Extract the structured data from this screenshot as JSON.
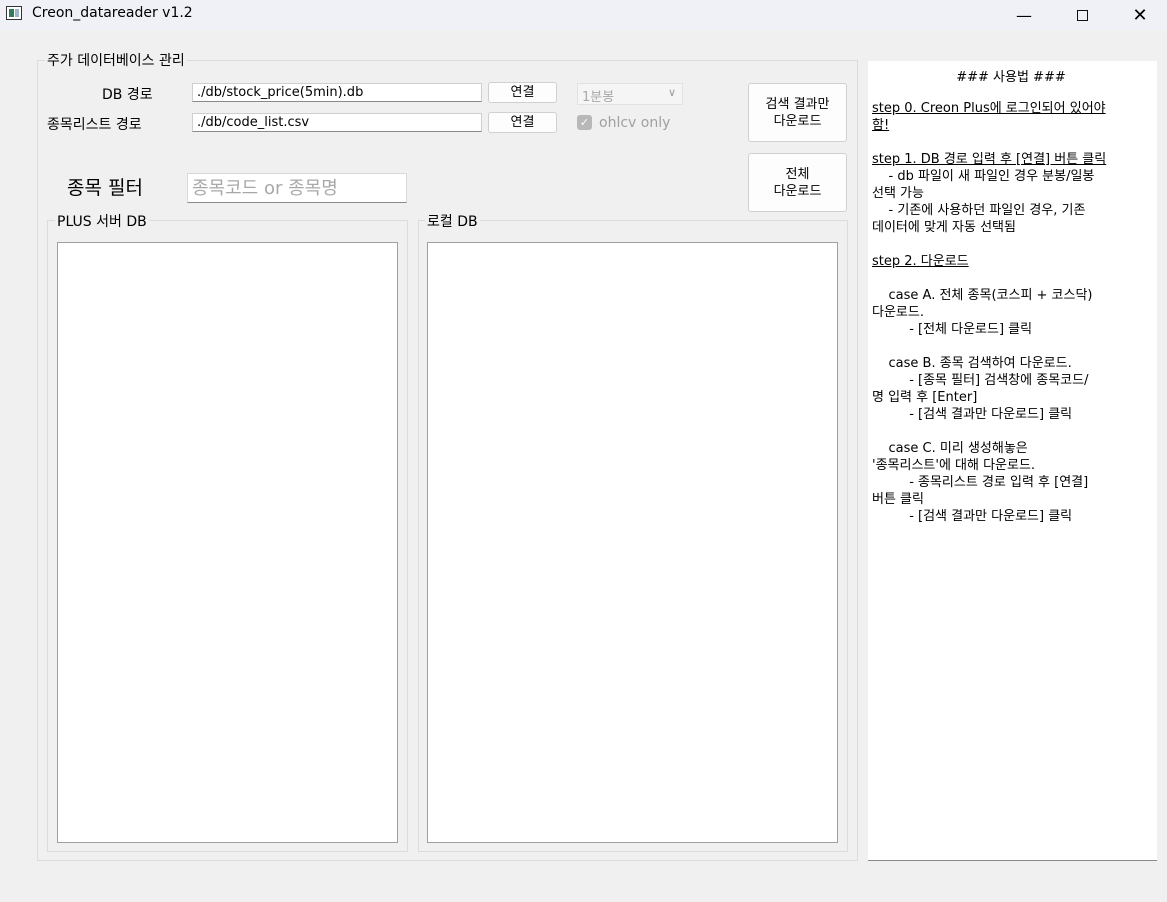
{
  "window": {
    "title": "Creon_datareader v1.2",
    "controls": {
      "minimize": "—",
      "close": "✕"
    }
  },
  "db_group": {
    "title": "주가 데이터베이스 관리",
    "db_path_label": "DB 경로",
    "db_path_value": "./db/stock_price(5min).db",
    "db_connect_label": "연결",
    "list_path_label": "종목리스트 경로",
    "list_path_value": "./db/code_list.csv",
    "list_connect_label": "연결",
    "interval_value": "1분봉",
    "ohlcv_only_label": "ohlcv only",
    "ohlcv_only_checked": true,
    "download_search_label": "검색 결과만\n다운로드",
    "download_all_label": "전체\n다운로드",
    "filter_label": "종목 필터",
    "filter_placeholder": "종목코드 or 종목명",
    "plus_server_title": "PLUS 서버 DB",
    "local_title": "로컬 DB"
  },
  "help": {
    "title": "### 사용법 ###",
    "lines": [
      {
        "text": "step 0. Creon Plus에 로그인되어 있어야",
        "u": true
      },
      {
        "text": "함!",
        "u": true
      },
      {
        "text": "",
        "u": false
      },
      {
        "text": "step 1. DB 경로 입력 후 [연결] 버튼 클릭",
        "u": true
      },
      {
        "text": "    - db 파일이 새 파일인 경우 분봉/일봉",
        "u": false
      },
      {
        "text": "선택 가능",
        "u": false
      },
      {
        "text": "    - 기존에 사용하던 파일인 경우, 기존",
        "u": false
      },
      {
        "text": "데이터에 맞게 자동 선택됨",
        "u": false
      },
      {
        "text": "",
        "u": false
      },
      {
        "text": "step 2. 다운로드",
        "u": true
      },
      {
        "text": "",
        "u": false
      },
      {
        "text": "    case A. 전체 종목(코스피 + 코스닥)",
        "u": false
      },
      {
        "text": "다운로드.",
        "u": false
      },
      {
        "text": "         - [전체 다운로드] 클릭",
        "u": false
      },
      {
        "text": "",
        "u": false
      },
      {
        "text": "    case B. 종목 검색하여 다운로드.",
        "u": false
      },
      {
        "text": "         - [종목 필터] 검색창에 종목코드/",
        "u": false
      },
      {
        "text": "명 입력 후 [Enter]",
        "u": false
      },
      {
        "text": "         - [검색 결과만 다운로드] 클릭",
        "u": false
      },
      {
        "text": "",
        "u": false
      },
      {
        "text": "    case C. 미리 생성해놓은",
        "u": false
      },
      {
        "text": "'종목리스트'에 대해 다운로드.",
        "u": false
      },
      {
        "text": "         - 종목리스트 경로 입력 후 [연결]",
        "u": false
      },
      {
        "text": "버튼 클릭",
        "u": false
      },
      {
        "text": "         - [검색 결과만 다운로드] 클릭",
        "u": false
      }
    ]
  }
}
